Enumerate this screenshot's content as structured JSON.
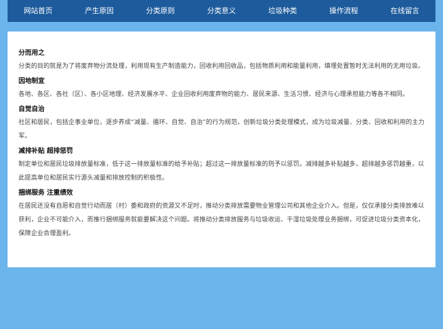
{
  "nav": {
    "items": [
      {
        "label": "网站首页"
      },
      {
        "label": "产生原因"
      },
      {
        "label": "分类原则"
      },
      {
        "label": "分类意义"
      },
      {
        "label": "垃圾种类"
      },
      {
        "label": "操作流程"
      },
      {
        "label": "在线留言"
      }
    ]
  },
  "content": {
    "sections": [
      {
        "heading": "分而用之",
        "body": "分类的目的就是为了将废弃物分流处理，利用现有生产制造能力，回收利用回收品，包括物质利用和能量利用，填埋处置暂时无法利用的无用垃圾。"
      },
      {
        "heading": "因地制宜",
        "body": "各地、各区、各社（区）、各小区地理、经济发展水平、企业回收利用废弃物的能力、居民来源、生活习惯、经济与心理承担能力等各不相同。"
      },
      {
        "heading": "自觉自治",
        "body": "社区和居民，包括企事业单位，逐步养成“减量、循环、自觉、自治”的行为规范，创新垃圾分类处理模式，成为垃圾减量、分类、回收和利用的主力军。"
      },
      {
        "heading": "减排补贴 超排惩罚",
        "body": "制定单位和居民垃圾排放量标准，低于这一排放量标准的给予补贴；超过这一排放量标准的则予以惩罚。减排越多补贴越多，超排越多惩罚越重，以此提高单位和居民实行源头减量和排放控制的积极性。"
      },
      {
        "heading": "捆绑服务 注重绩效",
        "body": "在居民还没有自愿和自觉行动而居（村）委和政府的资源又不足时，推动分类排放需要物业管理公司和其他企业介入。但是，仅仅承接分类排放难以获利，企业不可能介入，而推行捆绑服务就能要解决这个问题。将推动分类排放服务与垃圾收运、干湿垃圾处理业务捆绑，可促进垃圾分类资本化，保障企业合理盈利。"
      }
    ]
  },
  "colors": {
    "page_background": "#6cb4ec",
    "nav_background": "#1d5b9c",
    "nav_text": "#ffffff",
    "content_background": "#ffffff"
  }
}
